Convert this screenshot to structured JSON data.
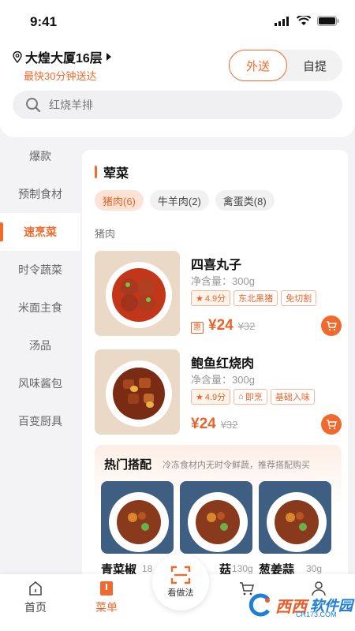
{
  "status_bar": {
    "time": "9:41"
  },
  "header": {
    "location": "大煌大厦16层",
    "delivery_time": "最快30分钟送达",
    "mode_tabs": [
      {
        "label": "外送",
        "active": true
      },
      {
        "label": "自提",
        "active": false
      }
    ],
    "search_placeholder": "红烧羊排"
  },
  "sidebar": {
    "items": [
      {
        "label": "爆款",
        "active": false
      },
      {
        "label": "预制食材",
        "active": false
      },
      {
        "label": "速烹菜",
        "active": true
      },
      {
        "label": "时令蔬菜",
        "active": false
      },
      {
        "label": "米面主食",
        "active": false
      },
      {
        "label": "汤品",
        "active": false
      },
      {
        "label": "风味酱包",
        "active": false
      },
      {
        "label": "百变厨具",
        "active": false
      }
    ]
  },
  "main": {
    "section_title": "荤菜",
    "chips": [
      {
        "label": "猪肉(6)",
        "active": true
      },
      {
        "label": "牛羊肉(2)",
        "active": false
      },
      {
        "label": "禽蛋类(8)",
        "active": false
      }
    ],
    "subcategory": "猪肉",
    "products": [
      {
        "name": "四喜丸子",
        "net": "净含量：300g",
        "tags": [
          "4.9分",
          "东北黑猪",
          "免切割"
        ],
        "coupon": "惠",
        "price": "¥24",
        "original_price": "¥32"
      },
      {
        "name": "鲍鱼红烧肉",
        "net": "净含量：300g",
        "tags": [
          "4.9分",
          "即烹",
          "基础入味"
        ],
        "coupon": "",
        "price": "¥24",
        "original_price": "¥32"
      }
    ],
    "hot_combo": {
      "title": "热门搭配",
      "desc": "冷冻食材内无时令鲜蔬，推荐搭配购买",
      "items": [
        {
          "name": "青菜椒",
          "weight": "18"
        },
        {
          "name": "菇",
          "weight": "130g"
        },
        {
          "name": "葱姜蒜",
          "weight": "30g"
        }
      ]
    }
  },
  "tabbar": {
    "tabs": [
      {
        "label": "首页",
        "icon": "home-icon",
        "active": false
      },
      {
        "label": "菜单",
        "icon": "menu-icon",
        "active": true
      },
      {
        "label": "",
        "icon": "cart-icon",
        "active": false
      },
      {
        "label": "",
        "icon": "profile-icon",
        "active": false
      }
    ],
    "scan_label": "看做法"
  },
  "watermark": {
    "brand1": "西西",
    "brand2": "软件园",
    "url": "CR173.COM"
  },
  "colors": {
    "accent": "#f06a2e",
    "accent_light": "#fde3d5"
  }
}
